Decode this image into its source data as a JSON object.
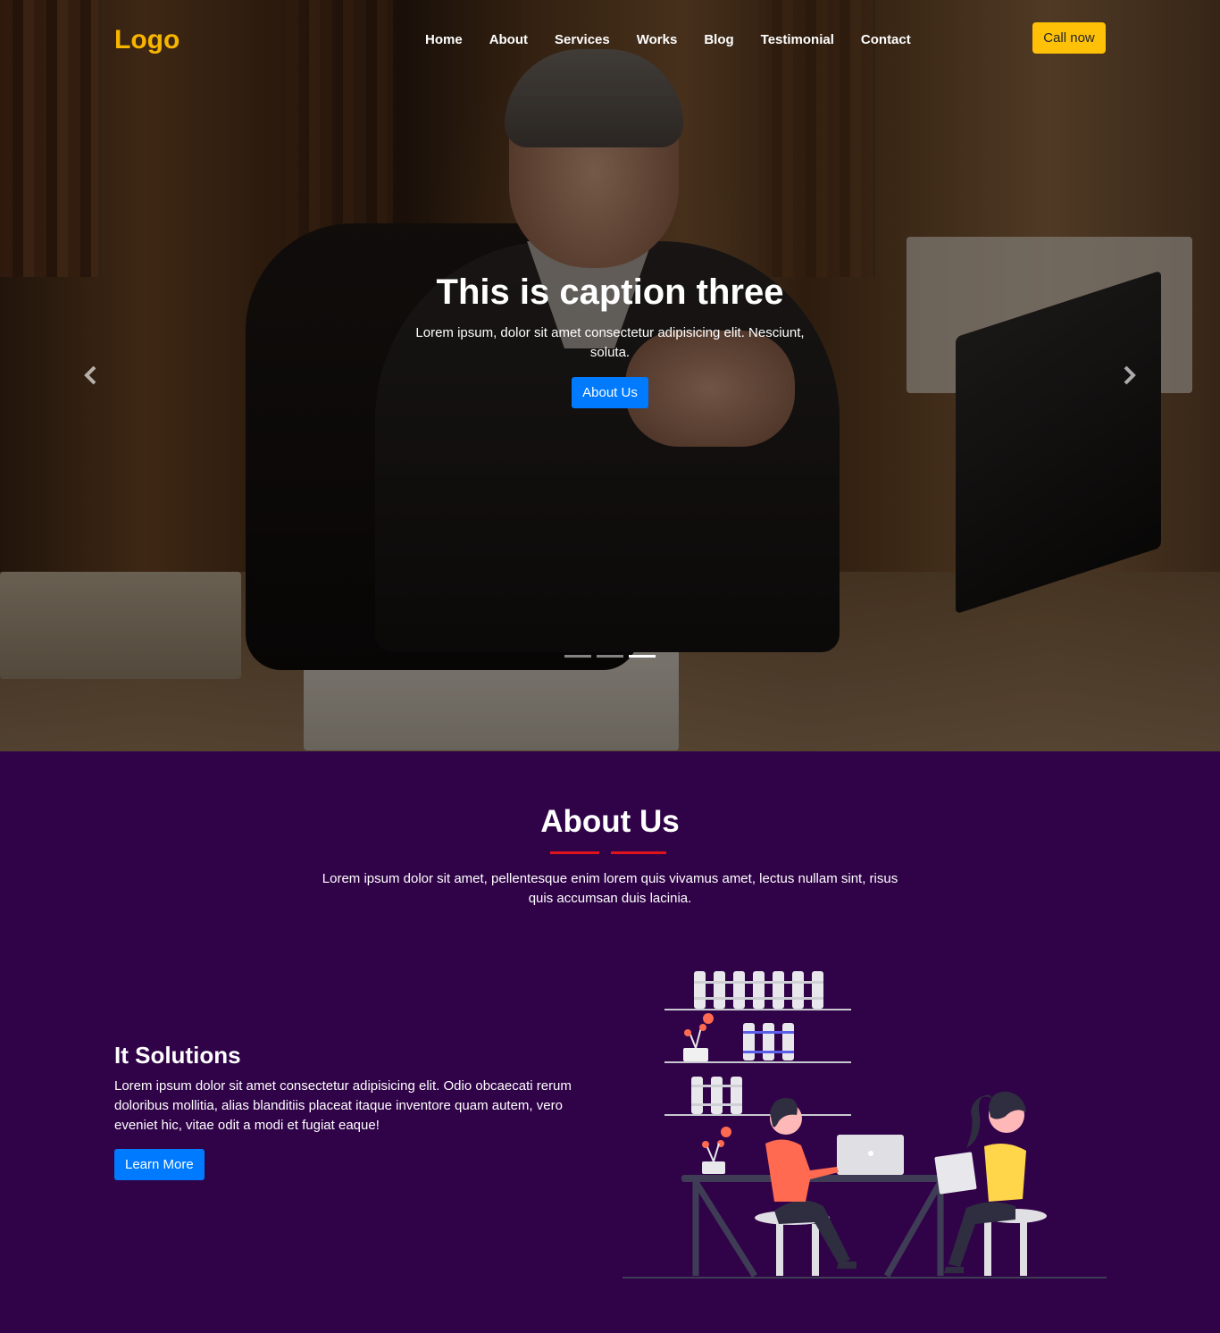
{
  "header": {
    "logo": "Logo",
    "menu": [
      "Home",
      "About",
      "Services",
      "Works",
      "Blog",
      "Testimonial",
      "Contact"
    ],
    "cta": "Call now"
  },
  "carousel": {
    "caption_title": "This is caption three",
    "caption_text": "Lorem ipsum, dolor sit amet consectetur adipisicing elit. Nesciunt, soluta.",
    "button": "About Us",
    "slide_count": 3,
    "active_slide": 3,
    "prev_icon": "chevron-left-icon",
    "next_icon": "chevron-right-icon"
  },
  "about": {
    "title": "About Us",
    "text": "Lorem ipsum dolor sit amet, pellentesque enim lorem quis vivamus amet, lectus nullam sint, risus quis accumsan duis lacinia.",
    "feature_title": "It Solutions",
    "feature_text": "Lorem ipsum dolor sit amet consectetur adipisicing elit. Odio obcaecati rerum doloribus mollitia, alias blanditiis placeat itaque inventore quam autem, vero eveniet hic, vitae odit a modi et fugiat eaque!",
    "feature_button": "Learn More"
  },
  "colors": {
    "logo": "#f7b500",
    "cta": "#ffc107",
    "primary_button": "#007bff",
    "section_bg": "#300348",
    "accent_underline": "#e0141b"
  }
}
